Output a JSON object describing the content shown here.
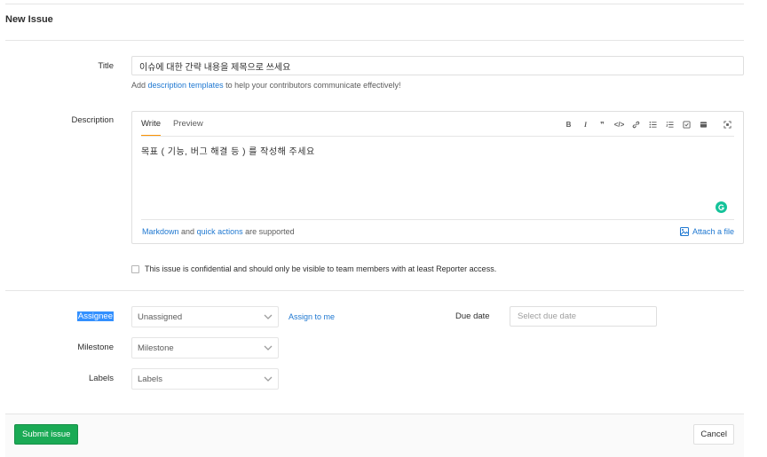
{
  "page": {
    "title": "New Issue"
  },
  "title_field": {
    "label": "Title",
    "value": "이슈에 대한 간략 내용을 제목으로 쓰세요",
    "helper_prefix": "Add",
    "helper_link": "description templates",
    "helper_suffix": "to help your contributors communicate effectively!"
  },
  "description": {
    "label": "Description",
    "tabs": [
      "Write",
      "Preview"
    ],
    "toolbar": [
      "bold-icon",
      "italic-icon",
      "quote-icon",
      "code-icon",
      "link-icon",
      "bullet-list-icon",
      "numbered-list-icon",
      "task-list-icon",
      "table-icon",
      "fullscreen-icon"
    ],
    "value": "목표 ( 기능, 버그 해결 등 ) 를 작성해 주세요",
    "footer_link1": "Markdown",
    "footer_and": "and",
    "footer_link2": "quick actions",
    "footer_suffix": "are supported",
    "attach_label": "Attach a file"
  },
  "confidential": {
    "checked": false,
    "label": "This issue is confidential and should only be visible to team members with at least Reporter access."
  },
  "assignee": {
    "label": "Assignee",
    "value": "Unassigned",
    "assign_to_me": "Assign to me"
  },
  "milestone": {
    "label": "Milestone",
    "value": "Milestone"
  },
  "labels": {
    "label": "Labels",
    "value": "Labels"
  },
  "due_date": {
    "label": "Due date",
    "placeholder": "Select due date"
  },
  "footer": {
    "submit_label": "Submit issue",
    "cancel_label": "Cancel"
  },
  "colors": {
    "link": "#1f78d1",
    "submit": "#1aaa55",
    "tab_active_underline": "#fc9403",
    "selection_highlight": "#3390ff"
  }
}
